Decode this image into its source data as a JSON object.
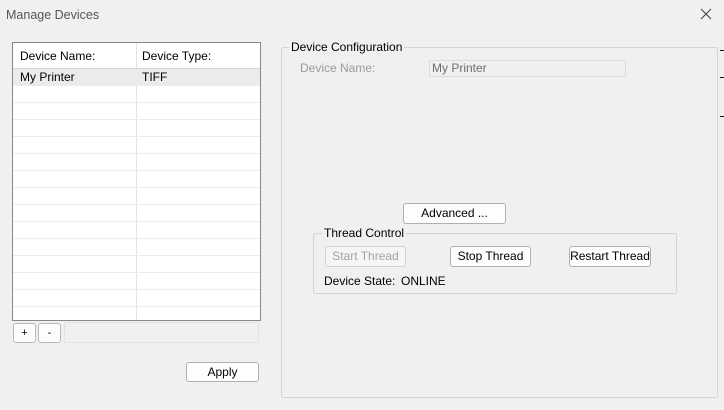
{
  "window": {
    "title": "Manage Devices"
  },
  "device_list": {
    "columns": [
      "Device Name:",
      "Device Type:"
    ],
    "rows": [
      {
        "name": "My Printer",
        "type": "TIFF",
        "selected": true
      }
    ],
    "add_label": "+",
    "remove_label": "-"
  },
  "apply_label": "Apply",
  "config": {
    "group_label": "Device Configuration",
    "device_name_label": "Device Name:",
    "device_name_value": "My Printer",
    "advanced_label": "Advanced ..."
  },
  "thread": {
    "group_label": "Thread Control",
    "start_label": "Start Thread",
    "stop_label": "Stop Thread",
    "restart_label": "Restart Thread",
    "state_label": "Device State:",
    "state_value": "ONLINE"
  },
  "icons": {
    "close": "close-icon"
  }
}
